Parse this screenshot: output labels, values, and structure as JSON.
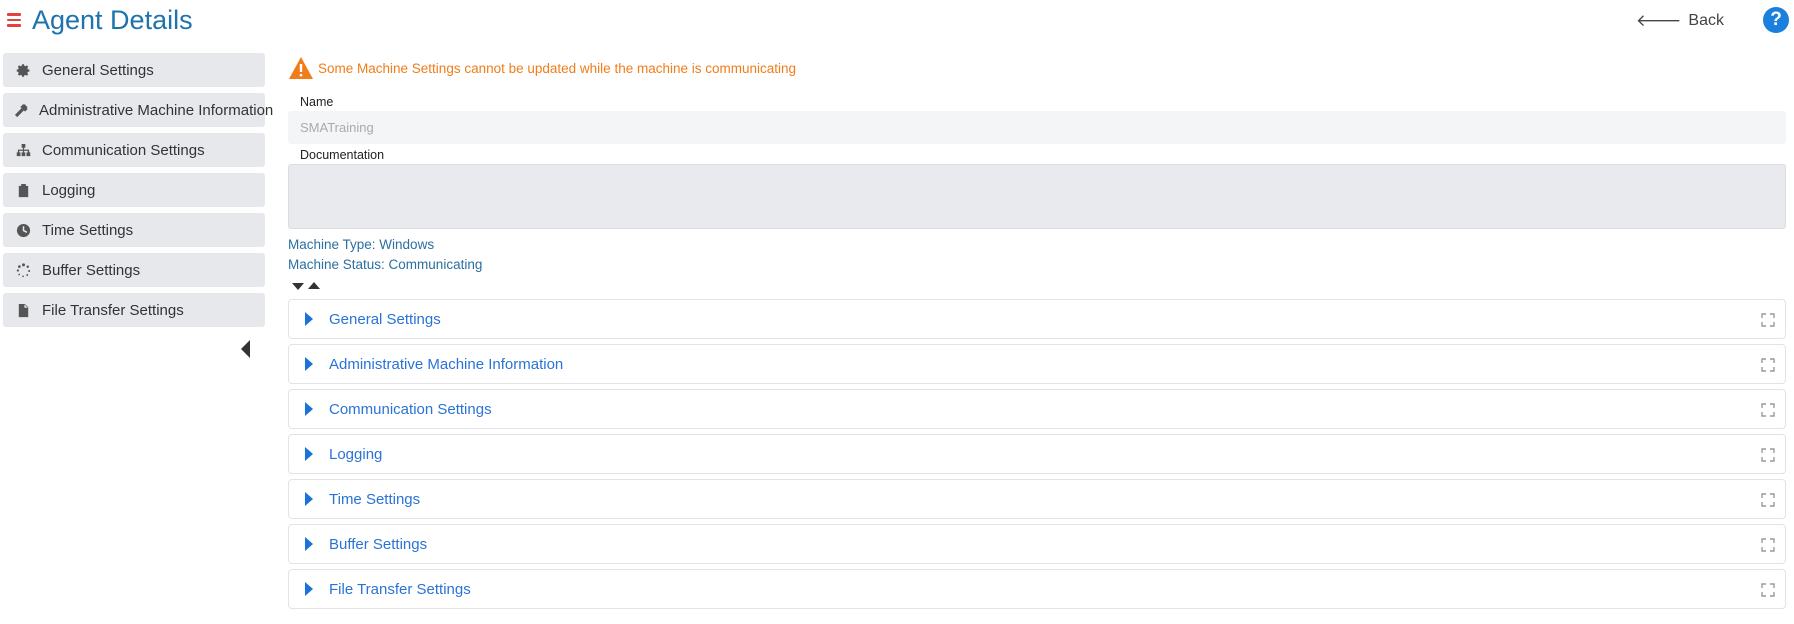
{
  "header": {
    "title": "Agent Details",
    "back_label": "Back",
    "help_label": "?"
  },
  "sidebar": {
    "items": [
      {
        "label": "General Settings",
        "icon": "gear-icon"
      },
      {
        "label": "Administrative Machine Information",
        "icon": "hammer-icon"
      },
      {
        "label": "Communication Settings",
        "icon": "network-icon"
      },
      {
        "label": "Logging",
        "icon": "clipboard-icon"
      },
      {
        "label": "Time Settings",
        "icon": "clock-icon"
      },
      {
        "label": "Buffer Settings",
        "icon": "spinner-icon"
      },
      {
        "label": "File Transfer Settings",
        "icon": "file-icon"
      }
    ]
  },
  "main": {
    "warning": "Some Machine Settings cannot be updated while the machine is communicating",
    "name_label": "Name",
    "name_value": "SMATraining",
    "documentation_label": "Documentation",
    "documentation_value": "",
    "machine_type": "Machine Type: Windows",
    "machine_status": "Machine Status: Communicating",
    "sections": [
      {
        "label": "General Settings"
      },
      {
        "label": "Administrative Machine Information"
      },
      {
        "label": "Communication Settings"
      },
      {
        "label": "Logging"
      },
      {
        "label": "Time Settings"
      },
      {
        "label": "Buffer Settings"
      },
      {
        "label": "File Transfer Settings"
      }
    ]
  },
  "colors": {
    "title": "#1f73ad",
    "warning": "#f07d1a",
    "menu_icon": "#e0443a",
    "help_button": "#1a7fdd",
    "section_label": "#2a73d6",
    "info_text": "#2a6fa0"
  }
}
